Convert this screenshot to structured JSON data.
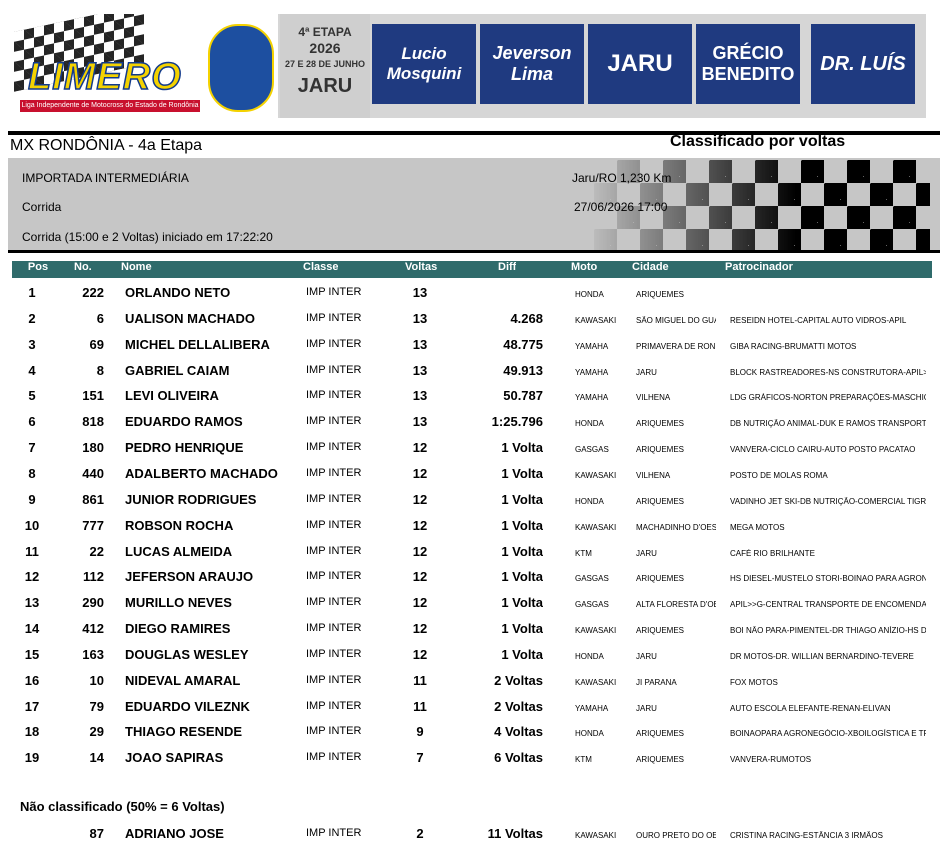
{
  "banner": {
    "logo_text": "LIMERO",
    "logo_subtitle": "Liga Independente de Motocross do Estado de Rondônia",
    "etapa": "4ª ETAPA",
    "year": "2026",
    "dates": "27 E 28 DE JUNHO",
    "city": "JARU",
    "sponsors": [
      "Lucio Mosquini",
      "Jeverson Lima",
      "JARU",
      "GRÉCIO BENEDITO",
      "DR. LUÍS"
    ]
  },
  "event": {
    "title": "MX RONDÔNIA - 4a Etapa",
    "sort_label": "Classificado por voltas",
    "category": "IMPORTADA INTERMEDIÁRIA",
    "session": "Corrida",
    "race_info": "Corrida (15:00 e 2 Voltas) iniciado em 17:22:20",
    "location": "Jaru/RO 1,230 Km",
    "datetime": "27/06/2026 17:00"
  },
  "table": {
    "headers": {
      "pos": "Pos",
      "no": "No.",
      "nome": "Nome",
      "classe": "Classe",
      "voltas": "Voltas",
      "diff": "Diff",
      "moto": "Moto",
      "cidade": "Cidade",
      "patrocinador": "Patrocinador"
    },
    "rows": [
      {
        "pos": "1",
        "no": "222",
        "nome": "ORLANDO NETO",
        "classe": "IMP INTER",
        "voltas": "13",
        "diff": "",
        "moto": "HONDA",
        "cidade": "ARIQUEMES",
        "patro": ""
      },
      {
        "pos": "2",
        "no": "6",
        "nome": "UALISON MACHADO",
        "classe": "IMP INTER",
        "voltas": "13",
        "diff": "4.268",
        "moto": "KAWASAKI",
        "cidade": "SÃO MIGUEL DO GUA",
        "patro": "RESEIDN HOTEL-CAPITAL AUTO VIDROS-APIL"
      },
      {
        "pos": "3",
        "no": "69",
        "nome": "MICHEL DELLALIBERA",
        "classe": "IMP INTER",
        "voltas": "13",
        "diff": "48.775",
        "moto": "YAMAHA",
        "cidade": "PRIMAVERA DE ROND",
        "patro": "GIBA RACING-BRUMATTI MOTOS"
      },
      {
        "pos": "4",
        "no": "8",
        "nome": "GABRIEL CAIAM",
        "classe": "IMP INTER",
        "voltas": "13",
        "diff": "49.913",
        "moto": "YAMAHA",
        "cidade": "JARU",
        "patro": "BLOCK RASTREADORES-NS CONSTRUTORA-APIL>>G"
      },
      {
        "pos": "5",
        "no": "151",
        "nome": "LEVI OLIVEIRA",
        "classe": "IMP INTER",
        "voltas": "13",
        "diff": "50.787",
        "moto": "YAMAHA",
        "cidade": "VILHENA",
        "patro": "LDG GRÁFICOS-NORTON PREPARAÇÕES-MASCHIO S"
      },
      {
        "pos": "6",
        "no": "818",
        "nome": "EDUARDO RAMOS",
        "classe": "IMP INTER",
        "voltas": "13",
        "diff": "1:25.796",
        "moto": "HONDA",
        "cidade": "ARIQUEMES",
        "patro": "DB NUTRIÇÃO ANIMAL-DUK E RAMOS TRANSPORTES"
      },
      {
        "pos": "7",
        "no": "180",
        "nome": "PEDRO HENRIQUE",
        "classe": "IMP INTER",
        "voltas": "12",
        "diff": "1 Volta",
        "moto": "GASGAS",
        "cidade": "ARIQUEMES",
        "patro": "VANVERA-CICLO CAIRU-AUTO POSTO PACATAO"
      },
      {
        "pos": "8",
        "no": "440",
        "nome": "ADALBERTO MACHADO",
        "classe": "IMP INTER",
        "voltas": "12",
        "diff": "1 Volta",
        "moto": "KAWASAKI",
        "cidade": "VILHENA",
        "patro": "POSTO DE MOLAS ROMA"
      },
      {
        "pos": "9",
        "no": "861",
        "nome": "JUNIOR RODRIGUES",
        "classe": "IMP INTER",
        "voltas": "12",
        "diff": "1 Volta",
        "moto": "HONDA",
        "cidade": "ARIQUEMES",
        "patro": "VADINHO JET SKI-DB NUTRIÇÃO-COMERCIAL TIGRE"
      },
      {
        "pos": "10",
        "no": "777",
        "nome": "ROBSON ROCHA",
        "classe": "IMP INTER",
        "voltas": "12",
        "diff": "1 Volta",
        "moto": "KAWASAKI",
        "cidade": "MACHADINHO D'OES",
        "patro": "MEGA MOTOS"
      },
      {
        "pos": "11",
        "no": "22",
        "nome": "LUCAS ALMEIDA",
        "classe": "IMP INTER",
        "voltas": "12",
        "diff": "1 Volta",
        "moto": "KTM",
        "cidade": "JARU",
        "patro": "CAFÉ RIO BRILHANTE"
      },
      {
        "pos": "12",
        "no": "112",
        "nome": "JEFERSON ARAUJO",
        "classe": "IMP INTER",
        "voltas": "12",
        "diff": "1 Volta",
        "moto": "GASGAS",
        "cidade": "ARIQUEMES",
        "patro": "HS DIESEL-MUSTELO STORI-BOINAO PARA AGRONE"
      },
      {
        "pos": "13",
        "no": "290",
        "nome": "MURILLO NEVES",
        "classe": "IMP INTER",
        "voltas": "12",
        "diff": "1 Volta",
        "moto": "GASGAS",
        "cidade": "ALTA FLORESTA D'OE",
        "patro": "APIL>>G-CENTRAL TRANSPORTE DE ENCOMENDA"
      },
      {
        "pos": "14",
        "no": "412",
        "nome": "DIEGO RAMIRES",
        "classe": "IMP INTER",
        "voltas": "12",
        "diff": "1 Volta",
        "moto": "KAWASAKI",
        "cidade": "ARIQUEMES",
        "patro": "BOI NÃO PARA-PIMENTEL-DR THIAGO ANÍZIO-HS D"
      },
      {
        "pos": "15",
        "no": "163",
        "nome": "DOUGLAS WESLEY",
        "classe": "IMP INTER",
        "voltas": "12",
        "diff": "1 Volta",
        "moto": "HONDA",
        "cidade": "JARU",
        "patro": "DR MOTOS-DR. WILLIAN BERNARDINO-TEVERE"
      },
      {
        "pos": "16",
        "no": "10",
        "nome": "NIDEVAL AMARAL",
        "classe": "IMP INTER",
        "voltas": "11",
        "diff": "2 Voltas",
        "moto": "KAWASAKI",
        "cidade": "JI PARANA",
        "patro": "FOX MOTOS"
      },
      {
        "pos": "17",
        "no": "79",
        "nome": "EDUARDO VILEZNK",
        "classe": "IMP INTER",
        "voltas": "11",
        "diff": "2 Voltas",
        "moto": "YAMAHA",
        "cidade": "JARU",
        "patro": "AUTO ESCOLA ELEFANTE-RENAN-ELIVAN"
      },
      {
        "pos": "18",
        "no": "29",
        "nome": "THIAGO RESENDE",
        "classe": "IMP INTER",
        "voltas": "9",
        "diff": "4 Voltas",
        "moto": "HONDA",
        "cidade": "ARIQUEMES",
        "patro": "BOINAOPARA AGRONEGÓCIO-XBOILOGÍSTICA E TR"
      },
      {
        "pos": "19",
        "no": "14",
        "nome": "JOAO SAPIRAS",
        "classe": "IMP INTER",
        "voltas": "7",
        "diff": "6 Voltas",
        "moto": "KTM",
        "cidade": "ARIQUEMES",
        "patro": "VANVERA-RUMOTOS"
      }
    ]
  },
  "not_classified": {
    "title": "Não classificado (50% = 6 Voltas)",
    "rows": [
      {
        "pos": "",
        "no": "87",
        "nome": "ADRIANO JOSE",
        "classe": "IMP INTER",
        "voltas": "2",
        "diff": "11 Voltas",
        "moto": "KAWASAKI",
        "cidade": "OURO PRETO DO OES",
        "patro": "CRISTINA RACING-ESTÂNCIA 3 IRMÃOS"
      }
    ]
  }
}
